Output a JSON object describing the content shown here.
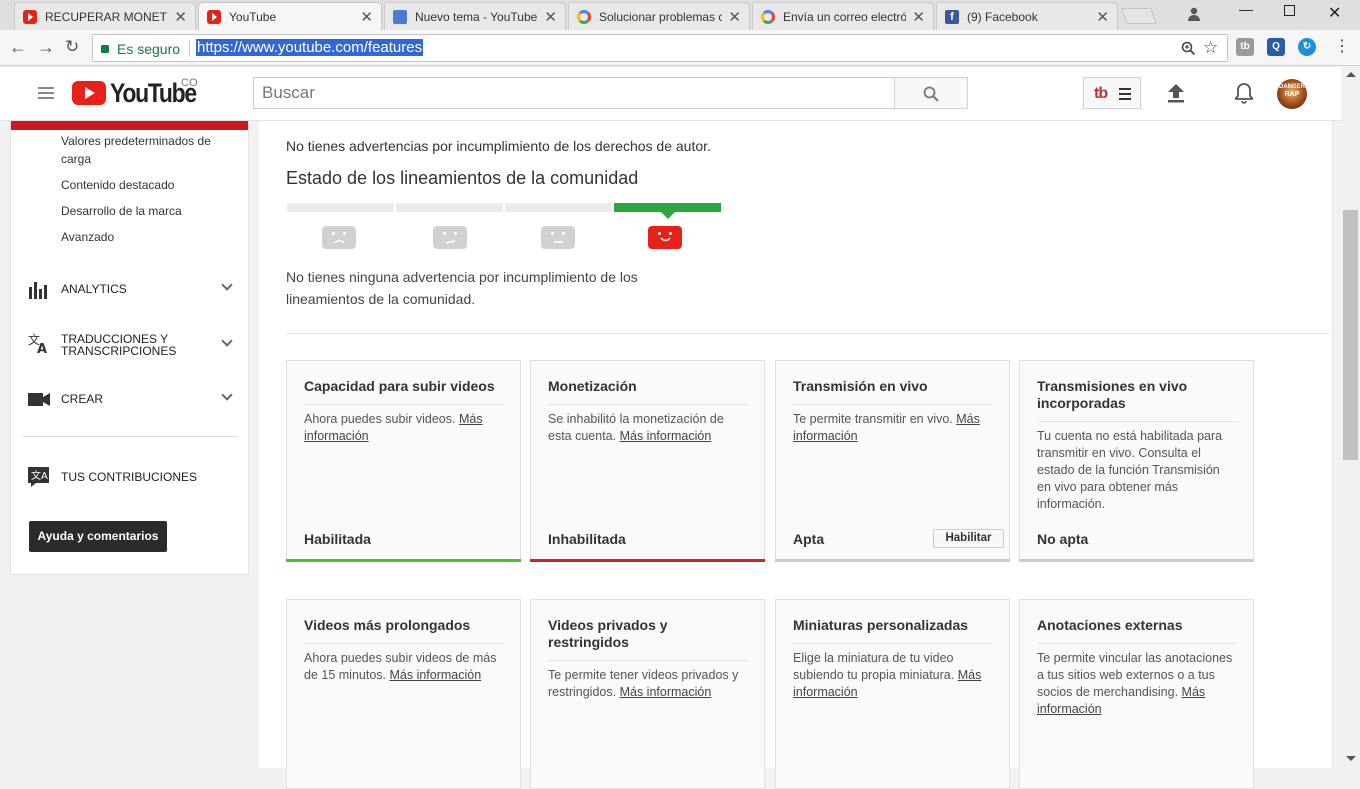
{
  "browser": {
    "tabs": [
      {
        "title": "RECUPERAR MONETIZA",
        "icon": "youtube-icon"
      },
      {
        "title": "YouTube",
        "icon": "youtube-icon",
        "active": true
      },
      {
        "title": "Nuevo tema - YouTube",
        "icon": "document-icon"
      },
      {
        "title": "Solucionar problemas c",
        "icon": "google-icon"
      },
      {
        "title": "Envía un correo electró",
        "icon": "google-icon"
      },
      {
        "title": "(9) Facebook",
        "icon": "facebook-icon"
      }
    ],
    "secure_label": "Es seguro",
    "url": "https://www.youtube.com/features",
    "facebook_letter": "f"
  },
  "header": {
    "logo_text": "YouTube",
    "country_code": "CO",
    "search_placeholder": "Buscar",
    "tubebuddy_mark": "tb",
    "avatar_text": [
      "DANGER",
      "RAP"
    ]
  },
  "sidebar": {
    "sub_items": [
      "Valores predeterminados de carga",
      "Contenido destacado",
      "Desarrollo de la marca",
      "Avanzado"
    ],
    "sections": [
      {
        "label": "ANALYTICS",
        "icon": "bar-chart-icon"
      },
      {
        "label": "TRADUCCIONES Y TRANSCRIPCIONES",
        "icon": "translate-icon"
      },
      {
        "label": "CREAR",
        "icon": "video-camera-icon"
      }
    ],
    "contributions": "TUS CONTRIBUCIONES",
    "help_button": "Ayuda y comentarios"
  },
  "main": {
    "copyright_text": "No tienes advertencias por incumplimiento de los derechos de autor.",
    "community_title": "Estado de los lineamientos de la comunidad",
    "community_desc": "No tienes ninguna advertencia por incumplimiento de los lineamientos de la comunidad.",
    "community_level": 4,
    "cards": [
      {
        "title": "Capacidad para subir videos",
        "desc": "Ahora puedes subir videos.",
        "link": "Más información",
        "status": "Habilitada",
        "bar_color": "#4cc42e"
      },
      {
        "title": "Monetización",
        "desc": "Se inhabilitó la monetización de esta cuenta.",
        "link": "Más información",
        "status": "Inhabilitada",
        "bar_color": "#d92020"
      },
      {
        "title": "Transmisión en vivo",
        "desc": "Te permite transmitir en vivo.",
        "link": "Más información",
        "status": "Apta",
        "button": "Habilitar",
        "bar_color": "#cccccc"
      },
      {
        "title": "Transmisiones en vivo incorporadas",
        "desc": "Tu cuenta no está habilitada para transmitir en vivo. Consulta el estado de la función Transmisión en vivo para obtener más información.",
        "status": "No apta",
        "bar_color": "#cccccc"
      },
      {
        "title": "Videos más prolongados",
        "desc": "Ahora puedes subir videos de más de 15 minutos.",
        "link": "Más información"
      },
      {
        "title": "Videos privados y restringidos",
        "desc": "Te permite tener videos privados y restringidos.",
        "link": "Más información"
      },
      {
        "title": "Miniaturas personalizadas",
        "desc": "Elige la miniatura de tu video subiendo tu propia miniatura.",
        "link": "Más información"
      },
      {
        "title": "Anotaciones externas",
        "desc": "Te permite vincular las anotaciones a tus sitios web externos o a tus socios de merchandising.",
        "link": "Más información"
      }
    ]
  }
}
